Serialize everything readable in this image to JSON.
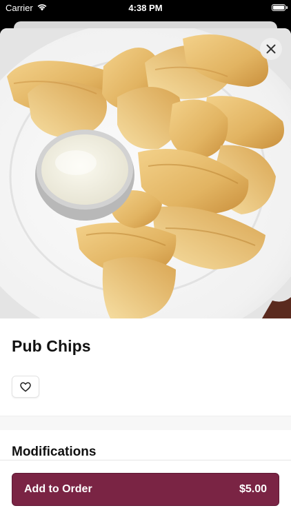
{
  "status_bar": {
    "carrier": "Carrier",
    "time": "4:38 PM",
    "wifi_icon": "wifi-icon",
    "battery_icon": "battery-icon"
  },
  "item": {
    "image_alt": "Pub Chips",
    "title": "Pub Chips",
    "favorite_icon": "heart-icon",
    "close_icon": "close-icon"
  },
  "sections": {
    "modifications_title": "Modifications"
  },
  "footer": {
    "add_label": "Add to Order",
    "price": "$5.00"
  },
  "colors": {
    "accent": "#7a2444",
    "background": "#ffffff",
    "divider": "#f7f7f7"
  }
}
